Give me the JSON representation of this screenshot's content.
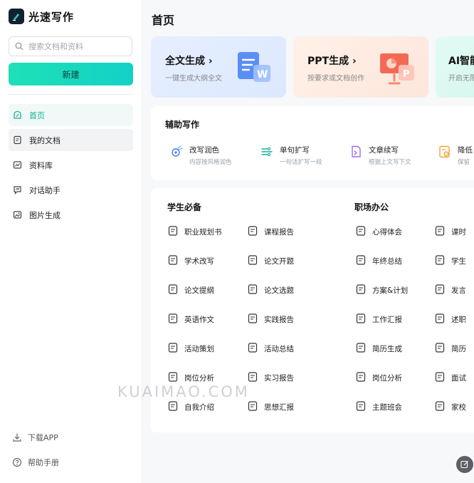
{
  "app": {
    "name": "光速写作"
  },
  "sidebar": {
    "search_placeholder": "搜索文档和资料",
    "new_button": "新建",
    "items": [
      {
        "label": "首页",
        "icon": "home-icon",
        "active": true
      },
      {
        "label": "我的文档",
        "icon": "document-icon"
      },
      {
        "label": "资料库",
        "icon": "library-icon"
      },
      {
        "label": "对话助手",
        "icon": "chat-icon"
      },
      {
        "label": "图片生成",
        "icon": "image-icon"
      }
    ],
    "bottom": [
      {
        "label": "下载APP",
        "icon": "download-icon"
      },
      {
        "label": "帮助手册",
        "icon": "help-icon"
      }
    ]
  },
  "main": {
    "title": "首页",
    "features": [
      {
        "title": "全文生成",
        "arrow": "›",
        "subtitle": "一键生成大纲全文"
      },
      {
        "title": "PPT生成",
        "arrow": "›",
        "subtitle": "按要求或文档创作"
      },
      {
        "title": "AI智能",
        "subtitle": "开启无限"
      }
    ],
    "assist": {
      "title": "辅助写作",
      "items": [
        {
          "title": "改写润色",
          "desc": "内容按风格润色",
          "icon": "rewrite-icon"
        },
        {
          "title": "单句扩写",
          "desc": "一句话扩写一段",
          "icon": "expand-icon"
        },
        {
          "title": "文章续写",
          "desc": "根据上文写下文",
          "icon": "continue-icon"
        },
        {
          "title": "降低",
          "desc": "保留",
          "icon": "reduce-icon"
        }
      ]
    },
    "student": {
      "title": "学生必备",
      "items": [
        "职业规划书",
        "课程报告",
        "学术改写",
        "论文开题",
        "论文提纲",
        "论文选题",
        "英语作文",
        "实践报告",
        "活动策划",
        "活动总结",
        "岗位分析",
        "实习报告",
        "自我介绍",
        "思想汇报"
      ]
    },
    "office": {
      "title": "职场办公",
      "items": [
        "心得体会",
        "课时",
        "年终总结",
        "学生",
        "方案&计划",
        "发言",
        "工作汇报",
        "述职",
        "简历生成",
        "简历",
        "岗位分析",
        "面试",
        "主题班会",
        "家校"
      ]
    }
  },
  "watermark": "KUAIMAO.COM",
  "colors": {
    "accent": "#13b296",
    "new_button_start": "#1fe0b6",
    "new_button_end": "#11d2c6"
  }
}
